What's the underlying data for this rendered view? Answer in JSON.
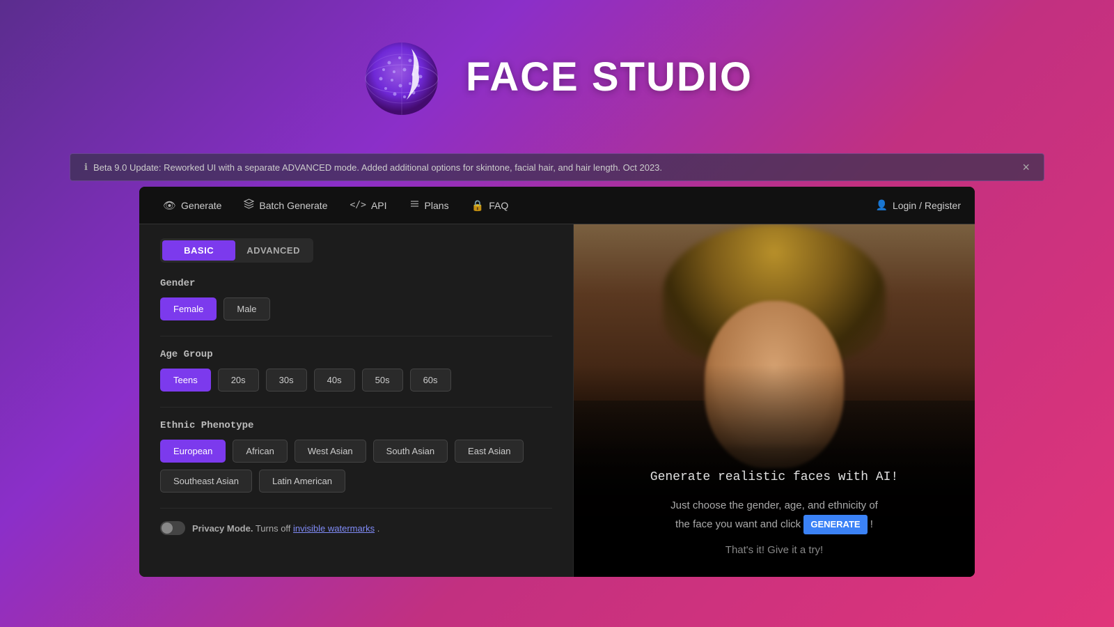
{
  "header": {
    "title": "FACE STUDIO"
  },
  "announcement": {
    "text": "Beta 9.0 Update: Reworked UI with a separate ADVANCED mode. Added additional options for skintone, facial hair, and hair length. Oct 2023.",
    "close_label": "×"
  },
  "navbar": {
    "items": [
      {
        "id": "generate",
        "label": "Generate",
        "icon": "👁"
      },
      {
        "id": "batch",
        "label": "Batch Generate",
        "icon": "🗂"
      },
      {
        "id": "api",
        "label": "API",
        "icon": "</>"
      },
      {
        "id": "plans",
        "label": "Plans",
        "icon": "☰"
      },
      {
        "id": "faq",
        "label": "FAQ",
        "icon": "🔒"
      }
    ],
    "auth": {
      "label": "Login / Register",
      "icon": "👤"
    }
  },
  "mode_tabs": {
    "basic": "BASIC",
    "advanced": "ADVANCED"
  },
  "gender": {
    "label": "Gender",
    "options": [
      {
        "id": "female",
        "label": "Female",
        "active": true
      },
      {
        "id": "male",
        "label": "Male",
        "active": false
      }
    ]
  },
  "age_group": {
    "label": "Age Group",
    "options": [
      {
        "id": "teens",
        "label": "Teens",
        "active": true
      },
      {
        "id": "20s",
        "label": "20s",
        "active": false
      },
      {
        "id": "30s",
        "label": "30s",
        "active": false
      },
      {
        "id": "40s",
        "label": "40s",
        "active": false
      },
      {
        "id": "50s",
        "label": "50s",
        "active": false
      },
      {
        "id": "60s",
        "label": "60s",
        "active": false
      }
    ]
  },
  "ethnic_phenotype": {
    "label": "Ethnic Phenotype",
    "options": [
      {
        "id": "european",
        "label": "European",
        "active": true
      },
      {
        "id": "african",
        "label": "African",
        "active": false
      },
      {
        "id": "west_asian",
        "label": "West Asian",
        "active": false
      },
      {
        "id": "south_asian",
        "label": "South Asian",
        "active": false
      },
      {
        "id": "east_asian",
        "label": "East Asian",
        "active": false
      },
      {
        "id": "southeast_asian",
        "label": "Southeast Asian",
        "active": false
      },
      {
        "id": "latin_american",
        "label": "Latin American",
        "active": false
      }
    ]
  },
  "privacy": {
    "label": "Privacy Mode.",
    "description": "Turns off",
    "link_text": "invisible watermarks",
    "suffix": "."
  },
  "right_panel": {
    "title": "Generate realistic faces with AI!",
    "description_prefix": "Just choose the gender, age, and ethnicity of\nthe face you want and click",
    "generate_btn_text": "GENERATE",
    "description_suffix": "!",
    "footer_text": "That's it! Give it a try!"
  }
}
